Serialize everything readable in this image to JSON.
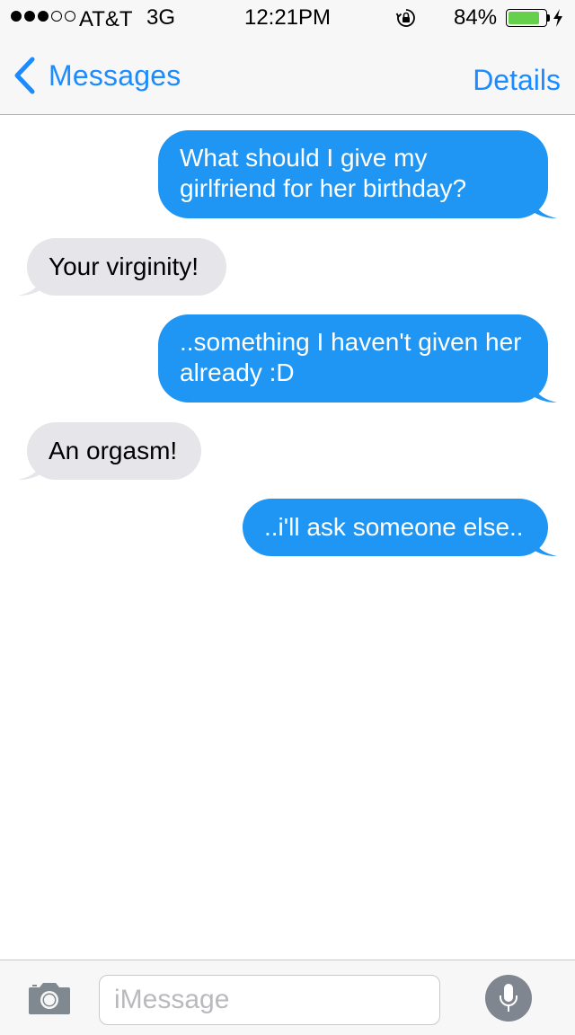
{
  "status_bar": {
    "signal_dots_filled": 3,
    "signal_dots_total": 5,
    "carrier": "AT&T",
    "network": "3G",
    "time": "12:21PM",
    "battery_percent_text": "84%",
    "battery_level": 0.84,
    "battery_color": "#65d04b"
  },
  "nav": {
    "back_label": "Messages",
    "details_label": "Details",
    "accent_color": "#1a8cff"
  },
  "messages": [
    {
      "direction": "outgoing",
      "text": "What should I give my girlfriend for her birthday?"
    },
    {
      "direction": "incoming",
      "text": "Your virginity!"
    },
    {
      "direction": "outgoing",
      "text": "..something I haven't given her already :D"
    },
    {
      "direction": "incoming",
      "text": "An orgasm!"
    },
    {
      "direction": "outgoing",
      "text": "..i'll ask someone else.."
    }
  ],
  "colors": {
    "outgoing_bubble": "#1f96f4",
    "incoming_bubble": "#e5e5ea"
  },
  "input_bar": {
    "camera_icon": "camera-icon",
    "placeholder": "iMessage",
    "value": "",
    "mic_icon": "microphone-icon"
  }
}
